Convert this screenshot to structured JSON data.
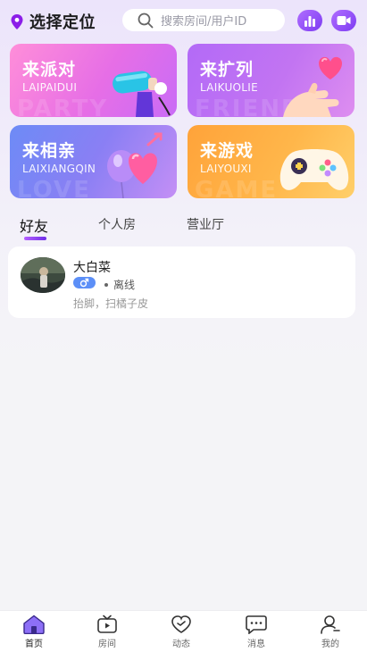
{
  "header": {
    "location_label": "选择定位",
    "search_placeholder": "搜索房间/用户ID"
  },
  "cards": [
    {
      "title": "来派对",
      "subtitle": "LAIPAIDUI"
    },
    {
      "title": "来扩列",
      "subtitle": "LAIKUOLIE"
    },
    {
      "title": "来相亲",
      "subtitle": "LAIXIANGQIN"
    },
    {
      "title": "来游戏",
      "subtitle": "LAIYOUXI"
    }
  ],
  "tabs": [
    {
      "label": "好友",
      "active": true
    },
    {
      "label": "个人房",
      "active": false
    },
    {
      "label": "营业厅",
      "active": false
    }
  ],
  "friends": [
    {
      "name": "大白菜",
      "gender": "male",
      "status": "离线",
      "description": "抬脚，扫橘子皮"
    }
  ],
  "bottom_nav": [
    {
      "label": "首页",
      "icon": "home-icon",
      "active": true
    },
    {
      "label": "房间",
      "icon": "tv-icon",
      "active": false
    },
    {
      "label": "动态",
      "icon": "heart-chat-icon",
      "active": false
    },
    {
      "label": "消息",
      "icon": "message-icon",
      "active": false
    },
    {
      "label": "我的",
      "icon": "user-icon",
      "active": false
    }
  ],
  "colors": {
    "accent": "#8b3ff5",
    "card_party": "#f06fcf",
    "card_expand": "#a55af5",
    "card_dating": "#6f8ef5",
    "card_game": "#fba23c"
  }
}
